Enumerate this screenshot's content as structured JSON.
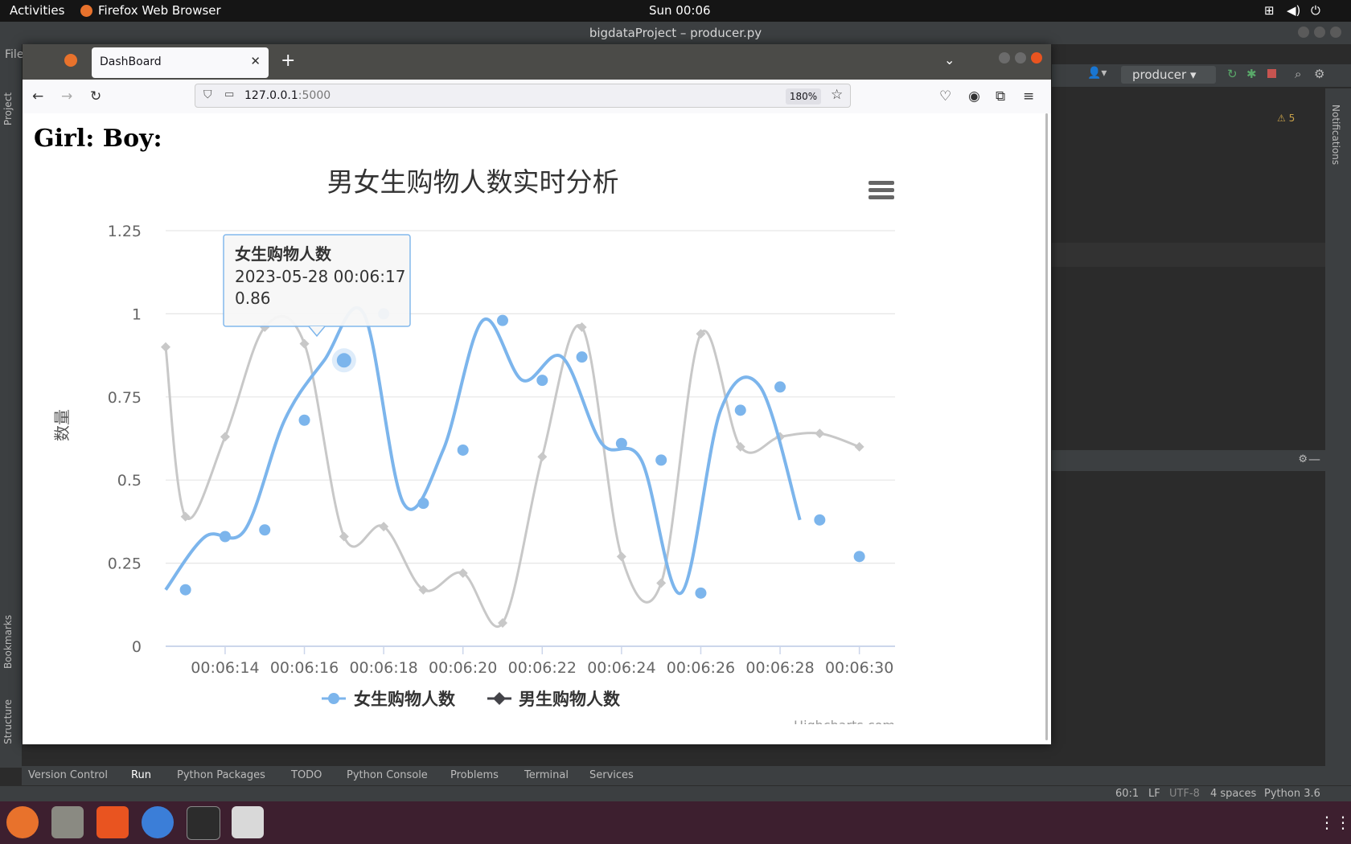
{
  "desktop": {
    "activities": "Activities",
    "app_menu": "Firefox Web Browser",
    "clock": "Sun 00:06"
  },
  "ide": {
    "window_title": "bigdataProject – producer.py",
    "menu_file": "File",
    "run_config": "producer",
    "project_tab": "Project",
    "bookmarks_tab": "Bookmarks",
    "structure_tab": "Structure",
    "notifications_tab": "Notifications",
    "warnings": "5",
    "bottom_tabs": [
      "Version Control",
      "Run",
      "Python Packages",
      "TODO",
      "Python Console",
      "Problems",
      "Terminal",
      "Services"
    ],
    "status": {
      "position": "60:1",
      "line_sep": "LF",
      "encoding": "UTF-8",
      "indent": "4 spaces",
      "interpreter": "Python 3.6"
    }
  },
  "browser": {
    "tab_title": "DashBoard",
    "url_host": "127.0.0.1",
    "url_port": ":5000",
    "zoom": "180%"
  },
  "page": {
    "heading": "Girl: Boy:"
  },
  "chart_data": {
    "type": "line",
    "title": "男女生购物人数实时分析",
    "ylabel": "数量",
    "xlabel": "",
    "ylim": [
      0,
      1.25
    ],
    "yticks": [
      "0",
      "0.25",
      "0.5",
      "0.75",
      "1",
      "1.25"
    ],
    "x_ticks": [
      "00:06:14",
      "00:06:16",
      "00:06:18",
      "00:06:20",
      "00:06:22",
      "00:06:24",
      "00:06:26",
      "00:06:28",
      "00:06:30"
    ],
    "grid": true,
    "legend_position": "bottom-center",
    "credits": "Highcharts.com",
    "series": [
      {
        "name": "女生购物人数",
        "color": "#7cb5ec",
        "marker": "circle",
        "points": [
          {
            "x": 13.0,
            "y": 0.17
          },
          {
            "x": 14.0,
            "y": 0.33
          },
          {
            "x": 15.0,
            "y": 0.35
          },
          {
            "x": 16.0,
            "y": 0.68
          },
          {
            "x": 17.0,
            "y": 0.86
          },
          {
            "x": 18.0,
            "y": 1.0
          },
          {
            "x": 19.0,
            "y": 0.43
          },
          {
            "x": 20.0,
            "y": 0.59
          },
          {
            "x": 21.0,
            "y": 0.98
          },
          {
            "x": 22.0,
            "y": 0.8
          },
          {
            "x": 23.0,
            "y": 0.87
          },
          {
            "x": 24.0,
            "y": 0.61
          },
          {
            "x": 25.0,
            "y": 0.56
          },
          {
            "x": 26.0,
            "y": 0.16
          },
          {
            "x": 27.0,
            "y": 0.71
          },
          {
            "x": 28.0,
            "y": 0.78
          },
          {
            "x": 29.0,
            "y": 0.38
          },
          {
            "x": 30.0,
            "y": 0.27
          }
        ]
      },
      {
        "name": "男生购物人数",
        "color": "#434348",
        "marker": "diamond",
        "points": [
          {
            "x": 12.5,
            "y": 0.9
          },
          {
            "x": 13.0,
            "y": 0.39
          },
          {
            "x": 14.0,
            "y": 0.63
          },
          {
            "x": 15.0,
            "y": 0.96
          },
          {
            "x": 16.0,
            "y": 0.91
          },
          {
            "x": 17.0,
            "y": 0.33
          },
          {
            "x": 18.0,
            "y": 0.36
          },
          {
            "x": 19.0,
            "y": 0.17
          },
          {
            "x": 20.0,
            "y": 0.22
          },
          {
            "x": 21.0,
            "y": 0.07
          },
          {
            "x": 22.0,
            "y": 0.57
          },
          {
            "x": 23.0,
            "y": 0.96
          },
          {
            "x": 24.0,
            "y": 0.27
          },
          {
            "x": 25.0,
            "y": 0.19
          },
          {
            "x": 26.0,
            "y": 0.94
          },
          {
            "x": 27.0,
            "y": 0.6
          },
          {
            "x": 28.0,
            "y": 0.63
          },
          {
            "x": 29.0,
            "y": 0.64
          },
          {
            "x": 30.0,
            "y": 0.6
          }
        ]
      }
    ],
    "tooltip": {
      "series": "女生购物人数",
      "time": "2023-05-28 00:06:17",
      "value": "0.86"
    }
  }
}
